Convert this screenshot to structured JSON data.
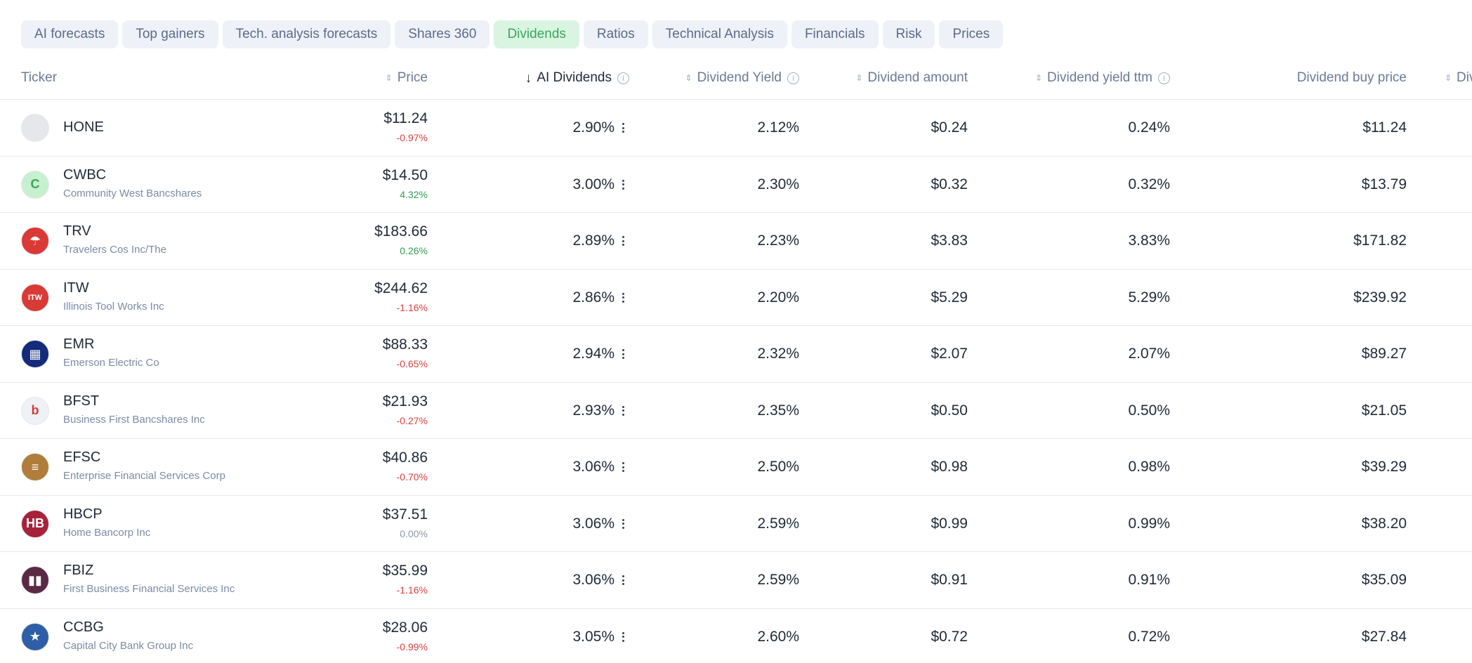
{
  "tabs": [
    {
      "label": "AI forecasts",
      "active": false
    },
    {
      "label": "Top gainers",
      "active": false
    },
    {
      "label": "Tech. analysis forecasts",
      "active": false
    },
    {
      "label": "Shares 360",
      "active": false
    },
    {
      "label": "Dividends",
      "active": true
    },
    {
      "label": "Ratios",
      "active": false
    },
    {
      "label": "Technical Analysis",
      "active": false
    },
    {
      "label": "Financials",
      "active": false
    },
    {
      "label": "Risk",
      "active": false
    },
    {
      "label": "Prices",
      "active": false
    }
  ],
  "columns": {
    "ticker": "Ticker",
    "price": "Price",
    "ai_dividends": "AI Dividends",
    "dividend_yield": "Dividend Yield",
    "dividend_amount": "Dividend amount",
    "dividend_yield_ttm": "Dividend yield ttm",
    "dividend_buy_price": "Dividend buy price",
    "next_column_partial": "Div"
  },
  "icons": {
    "sort": "sort-icon",
    "sort_desc": "arrow-down-icon",
    "info": "info-icon",
    "more": "more-vertical-icon"
  },
  "colors": {
    "active_tab_bg": "#d9f5e1",
    "active_tab_text": "#3aa55c",
    "negative": "#dc3f3f",
    "positive": "#2f9e55"
  },
  "rows": [
    {
      "symbol": "HONE",
      "name": "",
      "logo_text": "",
      "logo_color": "#e5e7eb",
      "price": "$11.24",
      "change": "-0.97%",
      "change_dir": "neg",
      "ai_dividends": "2.90%",
      "dividend_yield": "2.12%",
      "dividend_amount": "$0.24",
      "dividend_yield_ttm": "0.24%",
      "dividend_buy_price": "$11.24"
    },
    {
      "symbol": "CWBC",
      "name": "Community West Bancshares",
      "logo_text": "C",
      "logo_color": "#c7f0cf",
      "price": "$14.50",
      "change": "4.32%",
      "change_dir": "pos",
      "ai_dividends": "3.00%",
      "dividend_yield": "2.30%",
      "dividend_amount": "$0.32",
      "dividend_yield_ttm": "0.32%",
      "dividend_buy_price": "$13.79"
    },
    {
      "symbol": "TRV",
      "name": "Travelers Cos Inc/The",
      "logo_text": "☂",
      "logo_color": "#d93a35",
      "price": "$183.66",
      "change": "0.26%",
      "change_dir": "pos",
      "ai_dividends": "2.89%",
      "dividend_yield": "2.23%",
      "dividend_amount": "$3.83",
      "dividend_yield_ttm": "3.83%",
      "dividend_buy_price": "$171.82"
    },
    {
      "symbol": "ITW",
      "name": "Illinois Tool Works Inc",
      "logo_text": "ITW",
      "logo_color": "#d93a35",
      "price": "$244.62",
      "change": "-1.16%",
      "change_dir": "neg",
      "ai_dividends": "2.86%",
      "dividend_yield": "2.20%",
      "dividend_amount": "$5.29",
      "dividend_yield_ttm": "5.29%",
      "dividend_buy_price": "$239.92"
    },
    {
      "symbol": "EMR",
      "name": "Emerson Electric Co",
      "logo_text": "▦",
      "logo_color": "#142a7a",
      "price": "$88.33",
      "change": "-0.65%",
      "change_dir": "neg",
      "ai_dividends": "2.94%",
      "dividend_yield": "2.32%",
      "dividend_amount": "$2.07",
      "dividend_yield_ttm": "2.07%",
      "dividend_buy_price": "$89.27"
    },
    {
      "symbol": "BFST",
      "name": "Business First Bancshares Inc",
      "logo_text": "b",
      "logo_color": "#eef1f6",
      "price": "$21.93",
      "change": "-0.27%",
      "change_dir": "neg",
      "ai_dividends": "2.93%",
      "dividend_yield": "2.35%",
      "dividend_amount": "$0.50",
      "dividend_yield_ttm": "0.50%",
      "dividend_buy_price": "$21.05"
    },
    {
      "symbol": "EFSC",
      "name": "Enterprise Financial Services Corp",
      "logo_text": "≡",
      "logo_color": "#b07d3a",
      "price": "$40.86",
      "change": "-0.70%",
      "change_dir": "neg",
      "ai_dividends": "3.06%",
      "dividend_yield": "2.50%",
      "dividend_amount": "$0.98",
      "dividend_yield_ttm": "0.98%",
      "dividend_buy_price": "$39.29"
    },
    {
      "symbol": "HBCP",
      "name": "Home Bancorp Inc",
      "logo_text": "HB",
      "logo_color": "#a8213a",
      "price": "$37.51",
      "change": "0.00%",
      "change_dir": "zero",
      "ai_dividends": "3.06%",
      "dividend_yield": "2.59%",
      "dividend_amount": "$0.99",
      "dividend_yield_ttm": "0.99%",
      "dividend_buy_price": "$38.20"
    },
    {
      "symbol": "FBIZ",
      "name": "First Business Financial Services Inc",
      "logo_text": "▮▮",
      "logo_color": "#5a2a45",
      "price": "$35.99",
      "change": "-1.16%",
      "change_dir": "neg",
      "ai_dividends": "3.06%",
      "dividend_yield": "2.59%",
      "dividend_amount": "$0.91",
      "dividend_yield_ttm": "0.91%",
      "dividend_buy_price": "$35.09"
    },
    {
      "symbol": "CCBG",
      "name": "Capital City Bank Group Inc",
      "logo_text": "★",
      "logo_color": "#2f5ea8",
      "price": "$28.06",
      "change": "-0.99%",
      "change_dir": "neg",
      "ai_dividends": "3.05%",
      "dividend_yield": "2.60%",
      "dividend_amount": "$0.72",
      "dividend_yield_ttm": "0.72%",
      "dividend_buy_price": "$27.84"
    }
  ]
}
